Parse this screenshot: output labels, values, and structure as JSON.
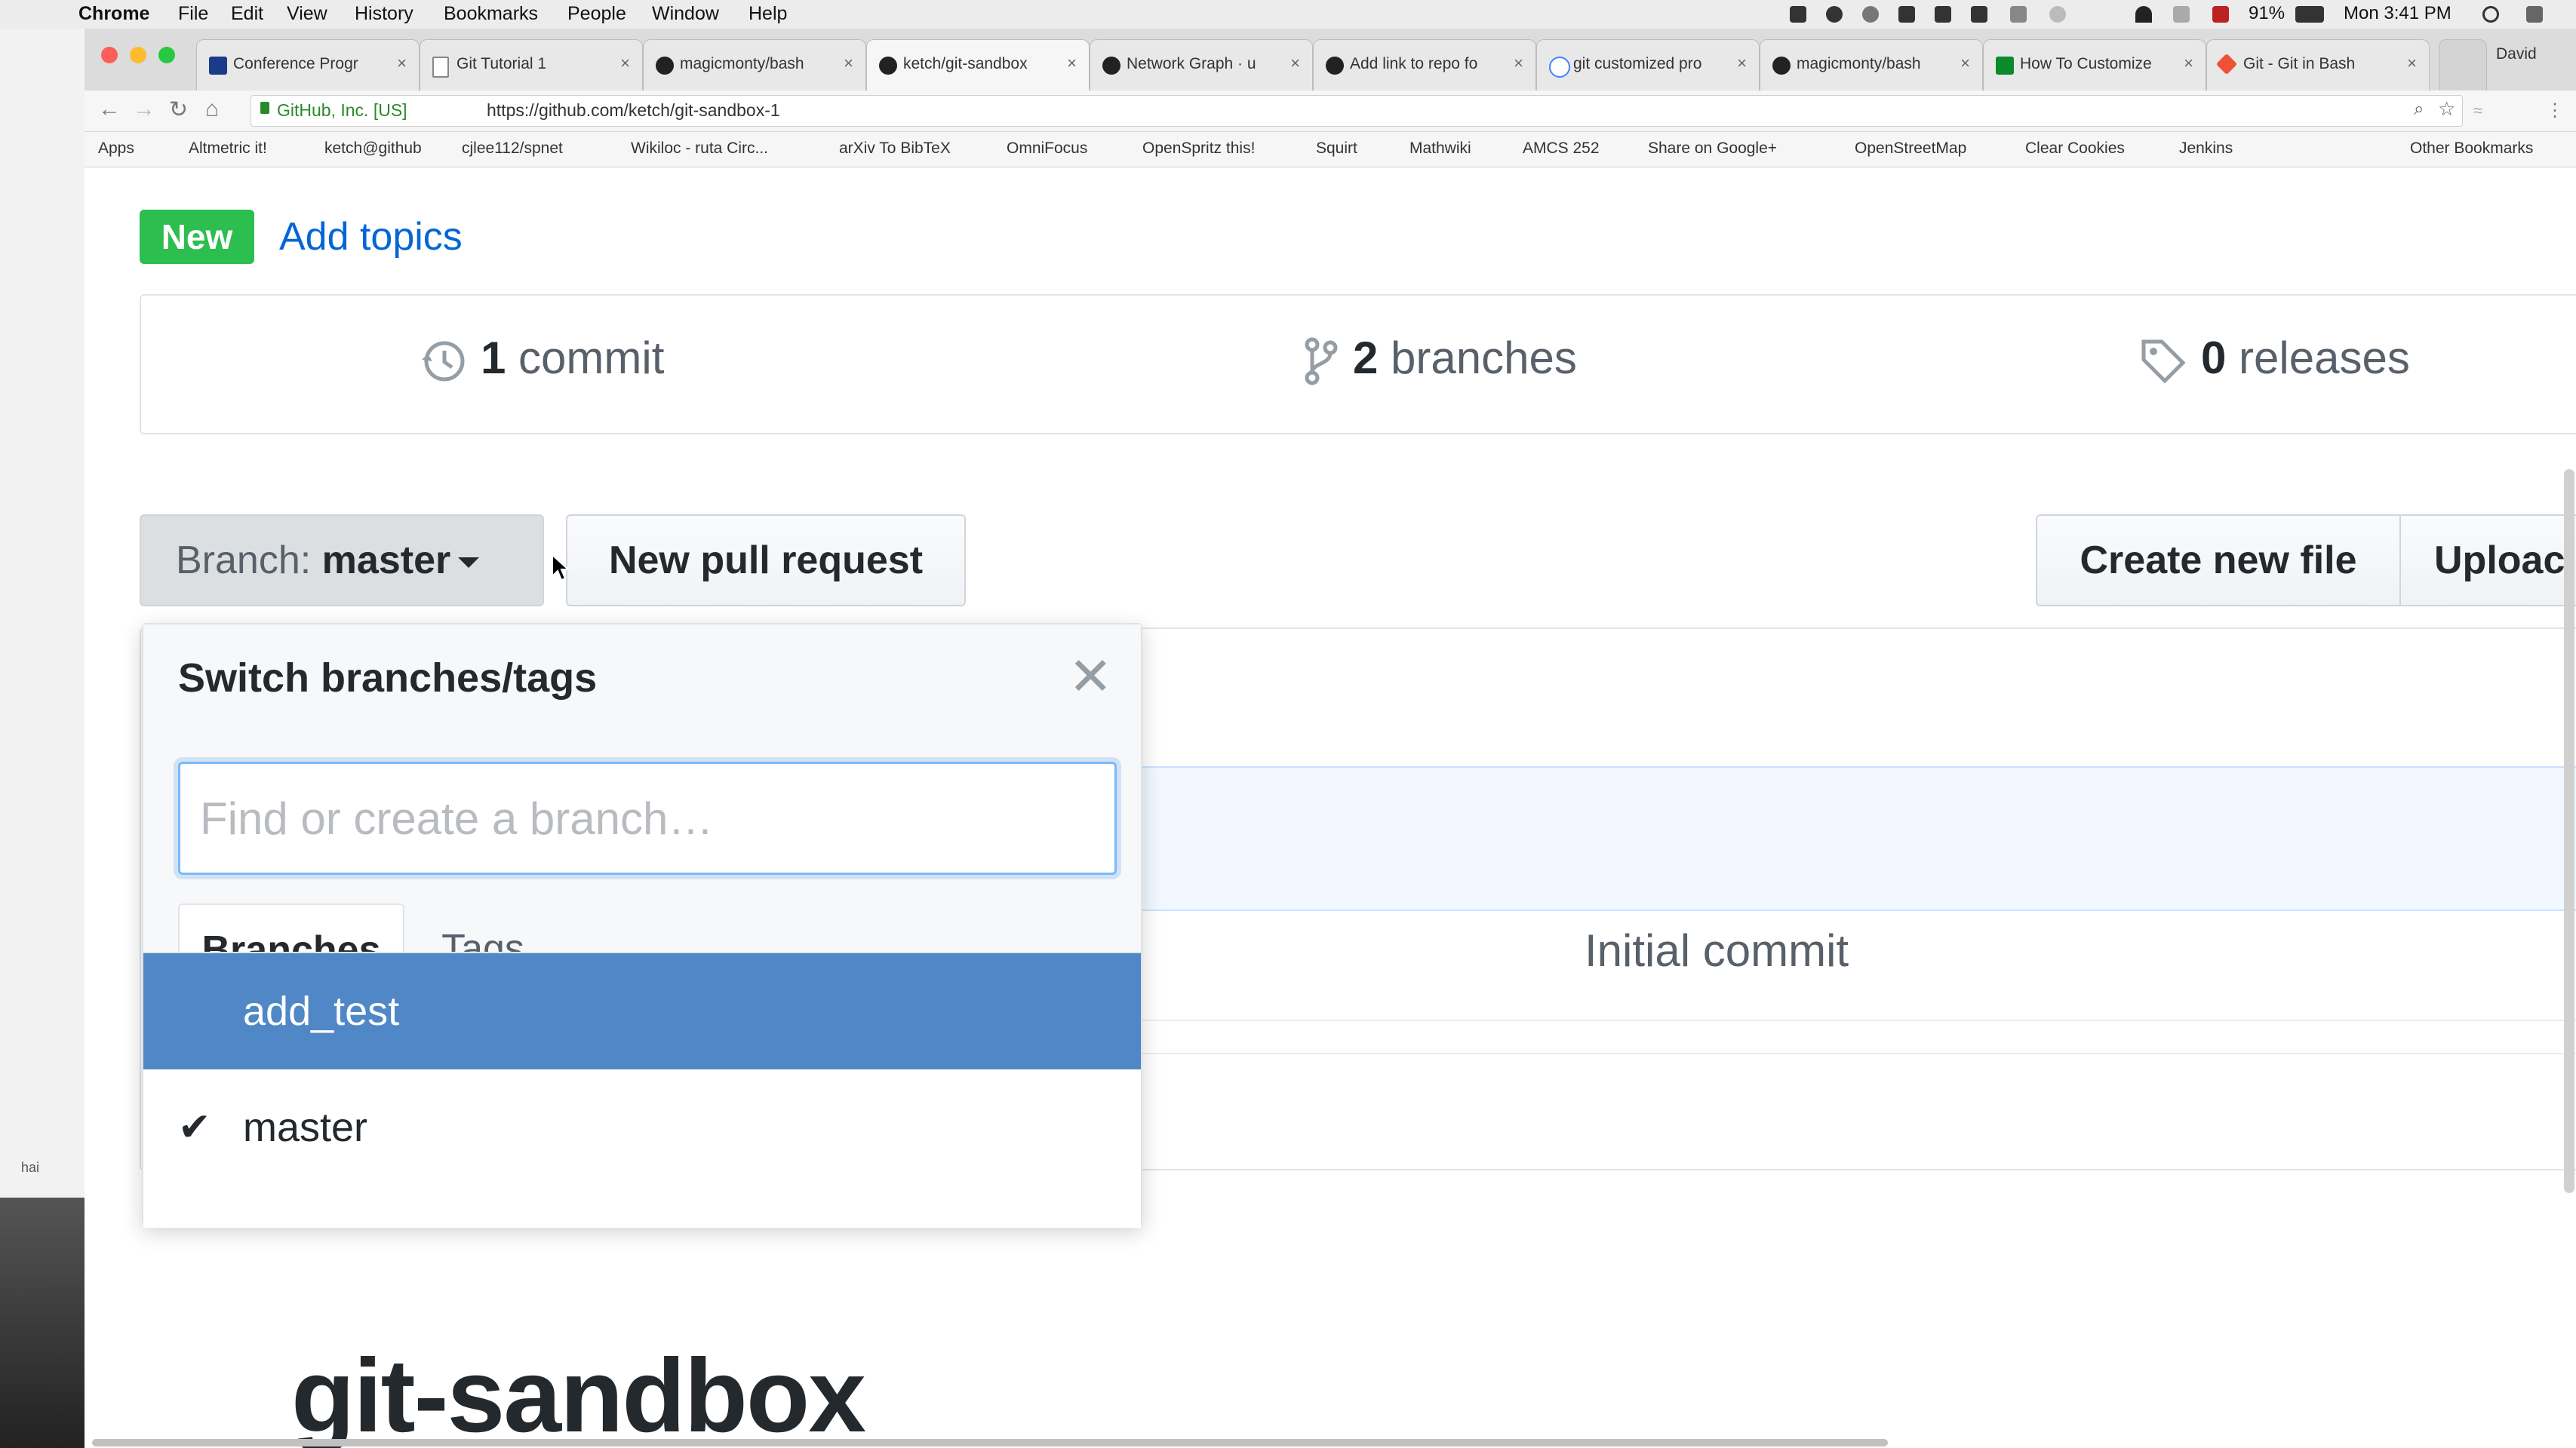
{
  "menubar": {
    "app": "Chrome",
    "items": [
      "File",
      "Edit",
      "View",
      "History",
      "Bookmarks",
      "People",
      "Window",
      "Help"
    ],
    "battery": "91%",
    "clock": "Mon 3:41 PM",
    "user": "David"
  },
  "tabs": [
    {
      "title": "Conference Progr",
      "active": false
    },
    {
      "title": "Git Tutorial 1",
      "active": false
    },
    {
      "title": "magicmonty/bash",
      "active": false
    },
    {
      "title": "ketch/git-sandbox",
      "active": true
    },
    {
      "title": "Network Graph · u",
      "active": false
    },
    {
      "title": "Add link to repo fo",
      "active": false
    },
    {
      "title": "git customized pro",
      "active": false
    },
    {
      "title": "magicmonty/bash",
      "active": false
    },
    {
      "title": "How To Customize",
      "active": false
    },
    {
      "title": "Git - Git in Bash",
      "active": false
    }
  ],
  "address": {
    "site_identity": "GitHub, Inc. [US]",
    "url": "https://github.com/ketch/git-sandbox-1"
  },
  "bookmarks": [
    "Apps",
    "Altmetric it!",
    "ketch@github",
    "cjlee112/spnet",
    "Wikiloc - ruta Circ...",
    "arXiv To BibTeX",
    "OmniFocus",
    "OpenSpritz this!",
    "Squirt",
    "Mathwiki",
    "AMCS 252",
    "Share on Google+",
    "OpenStreetMap",
    "Clear Cookies",
    "Jenkins",
    "Other Bookmarks"
  ],
  "left_window": {
    "chip": "hai"
  },
  "repo": {
    "new_badge": "New",
    "add_topics": "Add topics",
    "commits_count": "1",
    "commits_label": "commit",
    "branches_count": "2",
    "branches_label": "branches",
    "releases_count": "0",
    "releases_label": "releases",
    "branch_prefix": "Branch:",
    "branch_name": "master",
    "new_pull_request": "New pull request",
    "create_new_file": "Create new file",
    "upload": "Uploac",
    "commit_message": "Initial commit",
    "readme_title": "git-sandbox"
  },
  "branch_dropdown": {
    "title": "Switch branches/tags",
    "filter_placeholder": "Find or create a branch…",
    "tabs": [
      "Branches",
      "Tags"
    ],
    "branches": [
      {
        "name": "add_test",
        "highlighted": true,
        "selected": false
      },
      {
        "name": "master",
        "highlighted": false,
        "selected": true
      }
    ]
  },
  "colors": {
    "new_badge": "#2cbe4e",
    "link": "#0366d6",
    "highlight": "#4f87c7"
  }
}
